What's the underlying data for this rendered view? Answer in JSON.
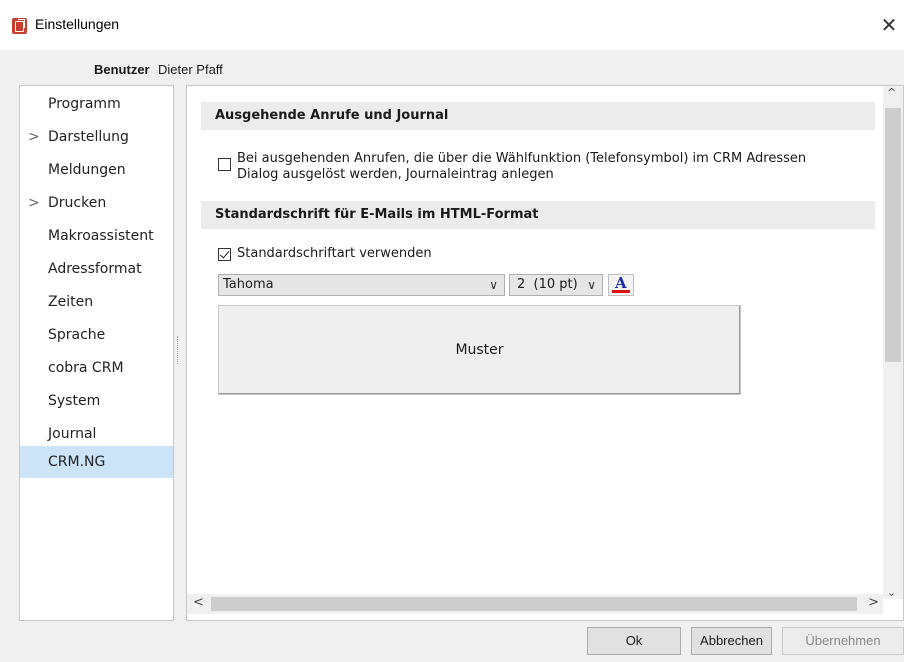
{
  "window": {
    "title": "Einstellungen",
    "close_symbol": "✕"
  },
  "user": {
    "label": "Benutzer",
    "name": "Dieter Pfaff"
  },
  "sidebar": {
    "items": [
      {
        "label": "Programm",
        "chevron": ""
      },
      {
        "label": "Darstellung",
        "chevron": ">"
      },
      {
        "label": "Meldungen",
        "chevron": ""
      },
      {
        "label": "Drucken",
        "chevron": ">"
      },
      {
        "label": "Makroassistent",
        "chevron": ""
      },
      {
        "label": "Adressformat",
        "chevron": ""
      },
      {
        "label": "Zeiten",
        "chevron": ""
      },
      {
        "label": "Sprache",
        "chevron": ""
      },
      {
        "label": "cobra CRM",
        "chevron": ""
      },
      {
        "label": "System",
        "chevron": ""
      },
      {
        "label": "Journal",
        "chevron": ""
      },
      {
        "label": "CRM.NG",
        "chevron": ""
      }
    ],
    "selected": "CRM.NG"
  },
  "content": {
    "section1": {
      "title": "Ausgehende Anrufe und Journal",
      "checkbox_line1": "Bei ausgehenden Anrufen, die über die Wählfunktion (Telefonsymbol) im CRM Adressen",
      "checkbox_line2": "Dialog ausgelöst werden, Journaleintrag anlegen",
      "checked": false
    },
    "section2": {
      "title": "Standardschrift für E-Mails im HTML-Format",
      "checkbox_label": "Standardschriftart verwenden",
      "checked": true,
      "font": "Tahoma",
      "size": "2  (10 pt)",
      "color_glyph": "A",
      "preview_text": "Muster"
    }
  },
  "scrollbars": {
    "up": "^",
    "down": "⌄",
    "left": "<",
    "right": ">"
  },
  "buttons": {
    "ok": "Ok",
    "cancel": "Abbrechen",
    "apply": "Übernehmen"
  },
  "colors": {
    "selected_item": "#cce4f7",
    "section_bg": "#ececec",
    "app_icon": "#c8412e",
    "font_color_bar": "#e01010"
  }
}
